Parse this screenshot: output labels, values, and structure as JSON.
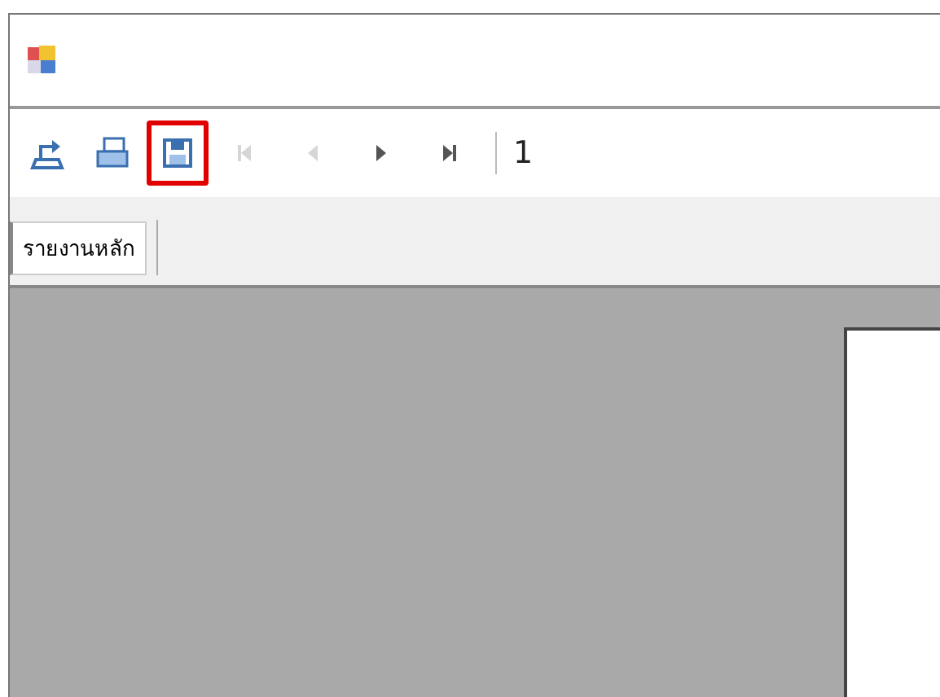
{
  "toolbar": {
    "buttons": [
      {
        "kind": "export",
        "disabled": false,
        "highlighted": false
      },
      {
        "kind": "print",
        "disabled": false,
        "highlighted": false
      },
      {
        "kind": "save",
        "disabled": false,
        "highlighted": true
      },
      {
        "kind": "first",
        "disabled": true,
        "highlighted": false
      },
      {
        "kind": "previous",
        "disabled": true,
        "highlighted": false
      },
      {
        "kind": "next",
        "disabled": false,
        "highlighted": false
      },
      {
        "kind": "last",
        "disabled": false,
        "highlighted": false
      }
    ],
    "page_field": {
      "value": "1"
    }
  },
  "tabs": [
    {
      "label": "รายงานหลัก",
      "selected": true
    }
  ]
}
